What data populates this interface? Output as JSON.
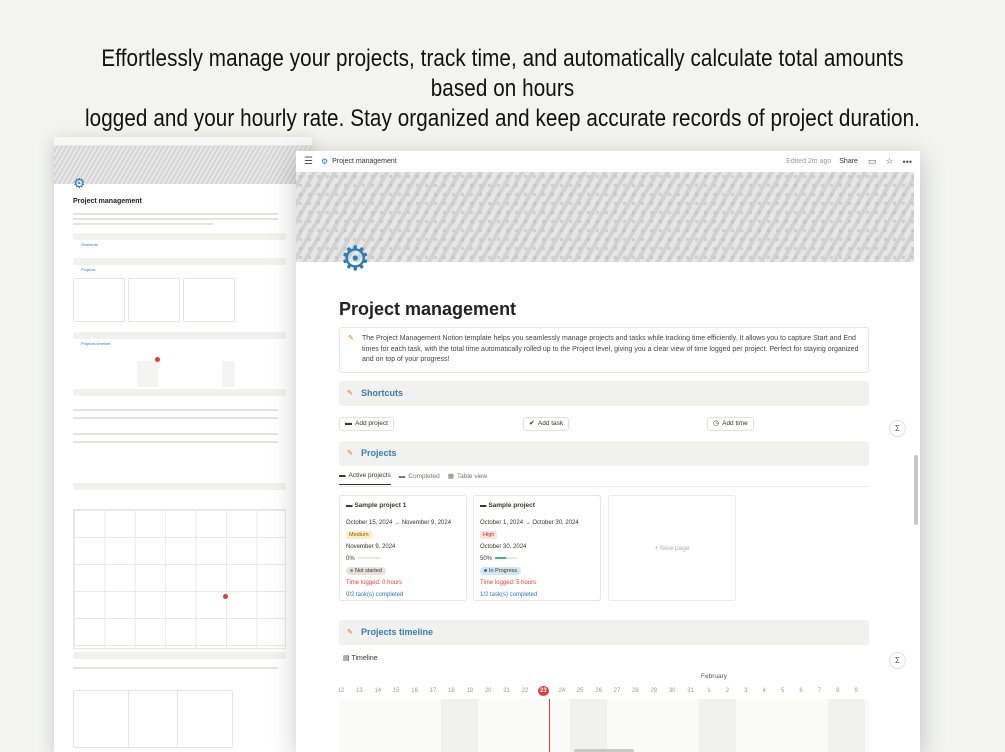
{
  "headline": {
    "line1": "Effortlessly manage your projects, track time, and automatically calculate total amounts based on hours",
    "line2": "logged and your hourly rate. Stay organized and keep accurate records of project duration."
  },
  "topbar": {
    "page_name": "Project management",
    "edited": "Edited 2m ago",
    "share": "Share"
  },
  "page": {
    "title": "Project management",
    "description": "The Project Management Notion template helps you seamlessly manage projects and tasks while tracking time efficiently. It allows you to capture Start and End times for each task, with the total time automatically rolled up to the Project level, giving you a clear view of time logged per project. Perfect for staying organized and on top of your progress!"
  },
  "shortcuts": {
    "heading": "Shortcuts",
    "add_project": "Add project",
    "add_task": "Add task",
    "add_time": "Add time"
  },
  "projects": {
    "heading": "Projects",
    "tabs": [
      "Active projects",
      "Completed",
      "Table view"
    ],
    "cards": [
      {
        "name": "Sample project 1",
        "dates": "October 15, 2024 → November 9, 2024",
        "priority": "Medium",
        "priority_color": "#fdecc8",
        "due": "November 9, 2024",
        "progress_label": "0%",
        "progress": 0,
        "status": "Not started",
        "status_bg": "#e3e2e0",
        "status_dot": "#91918e",
        "time_logged": "Time logged: 0 hours",
        "tasks": "0/2 task(s) completed"
      },
      {
        "name": "Sample project",
        "dates": "October 1, 2024 → October 30, 2024",
        "priority": "High",
        "priority_color": "#ffe2dd",
        "due": "October 30, 2024",
        "progress_label": "50%",
        "progress": 0.5,
        "status": "In Progress",
        "status_bg": "#d3e5ef",
        "status_dot": "#2e75b6",
        "time_logged": "Time logged: 5 hours",
        "tasks": "1/2 task(s) completed"
      }
    ],
    "new_page": "+ New page"
  },
  "timeline": {
    "heading": "Projects timeline",
    "view": "Timeline",
    "month": "February",
    "days": [
      "12",
      "13",
      "14",
      "15",
      "16",
      "17",
      "18",
      "19",
      "20",
      "21",
      "22",
      "23",
      "24",
      "25",
      "26",
      "27",
      "28",
      "29",
      "30",
      "31",
      "1",
      "2",
      "3",
      "4",
      "5",
      "6",
      "7",
      "8",
      "9"
    ],
    "today": "23"
  },
  "colors": {
    "accent": "#2f7bb6",
    "heading": "#3a7cae",
    "danger": "#e03e3e"
  }
}
